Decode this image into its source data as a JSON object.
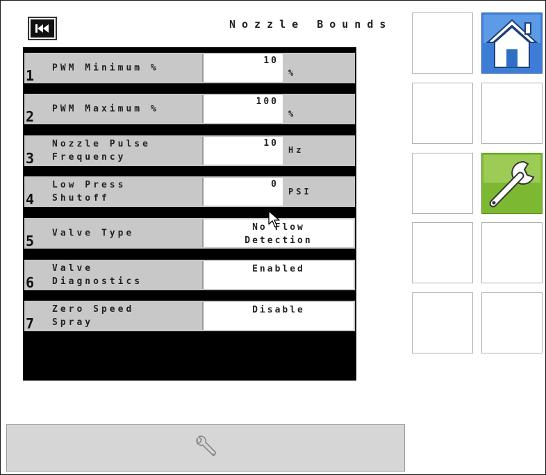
{
  "header": {
    "title": "Nozzle Bounds",
    "back_icon": "skip-back-icon"
  },
  "rows": [
    {
      "num": "1",
      "label": "PWM Minimum %",
      "value": "10",
      "unit": "%"
    },
    {
      "num": "2",
      "label": "PWM Maximum %",
      "value": "100",
      "unit": "%"
    },
    {
      "num": "3",
      "label": "Nozzle Pulse\nFrequency",
      "value": "10",
      "unit": "Hz"
    },
    {
      "num": "4",
      "label": "Low Press\nShutoff",
      "value": "0",
      "unit": "PSI"
    },
    {
      "num": "5",
      "label": "Valve Type",
      "value": "No Flow\nDetection",
      "unit": ""
    },
    {
      "num": "6",
      "label": "Valve\nDiagnostics",
      "value": "Enabled",
      "unit": ""
    },
    {
      "num": "7",
      "label": "Zero Speed\nSpray",
      "value": "Disable",
      "unit": ""
    }
  ],
  "side_buttons": {
    "home_icon": "home-icon",
    "settings_icon": "wrench-icon"
  },
  "bottom": {
    "icon": "wrench-icon"
  },
  "colors": {
    "home": "#3d7dd6",
    "settings": "#7cb832",
    "row": "#c8c8c8",
    "panel": "#000000"
  }
}
